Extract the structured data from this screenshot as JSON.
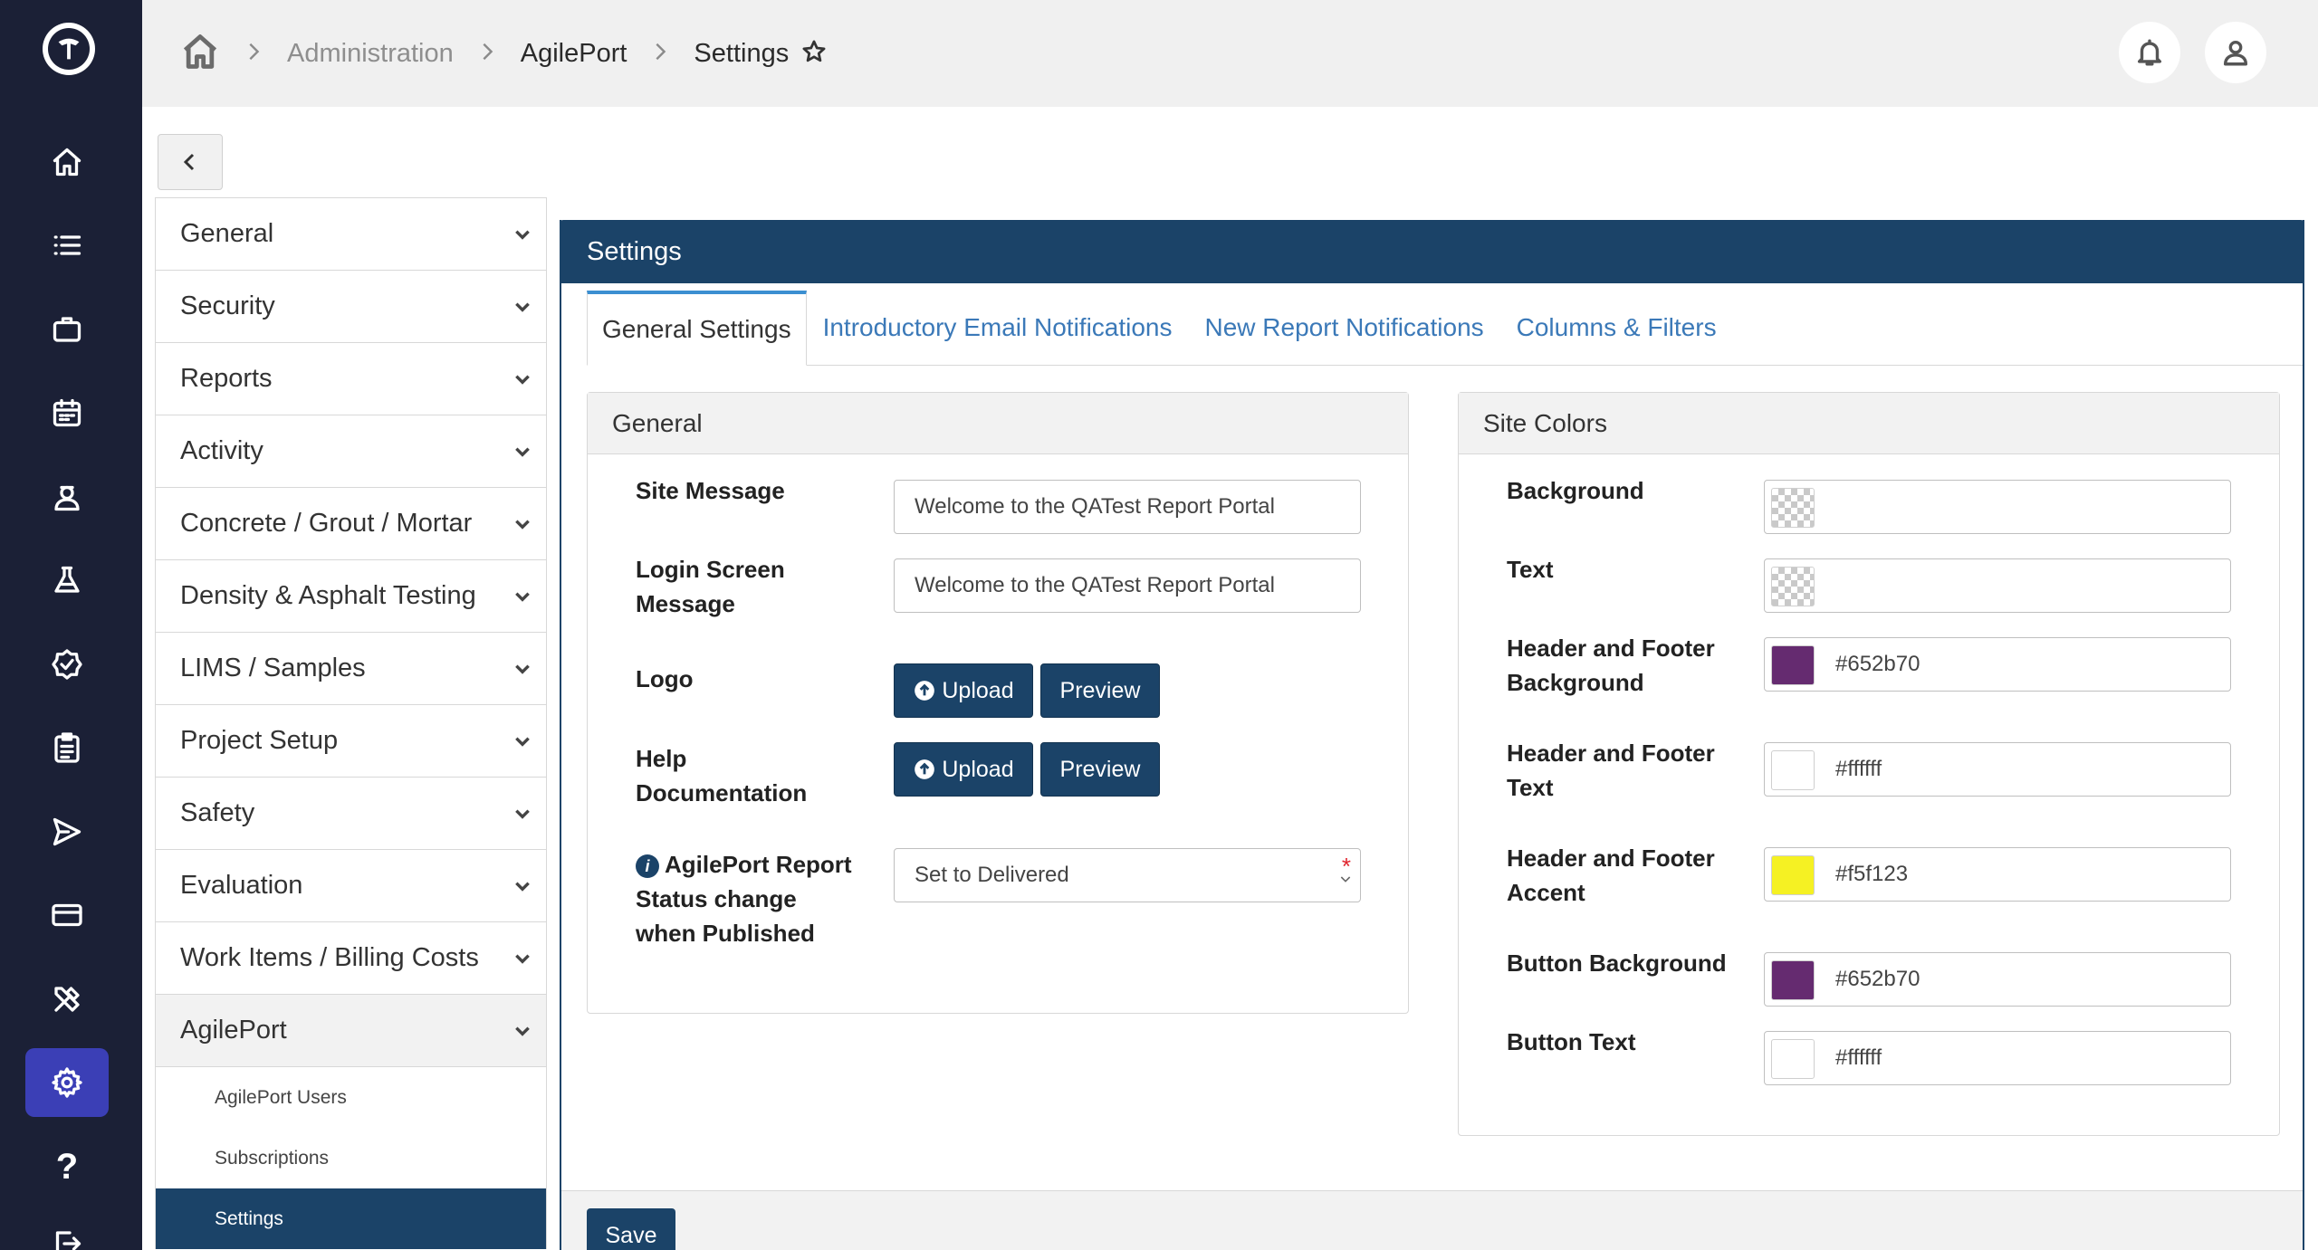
{
  "breadcrumb": {
    "items": [
      "Administration",
      "AgilePort",
      "Settings"
    ]
  },
  "sidebar": {
    "items": [
      {
        "label": "General"
      },
      {
        "label": "Security"
      },
      {
        "label": "Reports"
      },
      {
        "label": "Activity"
      },
      {
        "label": "Concrete / Grout / Mortar"
      },
      {
        "label": "Density & Asphalt Testing"
      },
      {
        "label": "LIMS / Samples"
      },
      {
        "label": "Project Setup"
      },
      {
        "label": "Safety"
      },
      {
        "label": "Evaluation"
      },
      {
        "label": "Work Items / Billing Costs"
      },
      {
        "label": "AgilePort"
      }
    ],
    "subitems": [
      "AgilePort Users",
      "Subscriptions",
      "Settings"
    ]
  },
  "panel": {
    "title": "Settings",
    "tabs": [
      "General Settings",
      "Introductory Email Notifications",
      "New Report Notifications",
      "Columns & Filters"
    ]
  },
  "general": {
    "title": "General",
    "site_message_label": "Site Message",
    "site_message_value": "Welcome to the QATest Report Portal",
    "login_label_1": "Login Screen",
    "login_label_2": "Message",
    "login_value": "Welcome to the QATest Report Portal",
    "logo_label": "Logo",
    "help_label_1": "Help",
    "help_label_2": "Documentation",
    "upload_label": "Upload",
    "preview_label": "Preview",
    "status_label_1": "AgilePort Report",
    "status_label_2": "Status change",
    "status_label_3": "when Published",
    "status_value": "Set to Delivered",
    "required_mark": "*"
  },
  "site_colors": {
    "title": "Site Colors",
    "rows": [
      {
        "label": "Background",
        "value": "",
        "color": "transparent"
      },
      {
        "label": "Text",
        "value": "",
        "color": "transparent"
      },
      {
        "label": "Header and Footer Background",
        "line1": "Header and Footer",
        "line2": "Background",
        "value": "#652b70",
        "color": "#652b70"
      },
      {
        "label": "Header and Footer Text",
        "line1": "Header and Footer",
        "line2": "Text",
        "value": "#ffffff",
        "color": "#ffffff"
      },
      {
        "label": "Header and Footer Accent",
        "line1": "Header and Footer",
        "line2": "Accent",
        "value": "#f5f123",
        "color": "#f5f123"
      },
      {
        "label": "Button Background",
        "value": "#652b70",
        "color": "#652b70"
      },
      {
        "label": "Button Text",
        "value": "#ffffff",
        "color": "#ffffff"
      }
    ]
  },
  "footer": {
    "save_label": "Save"
  },
  "theme": {
    "rail_bg": "#1b2036",
    "rail_active": "#3b3fb6",
    "primary": "#1b4368",
    "tab_link": "#3b79b8"
  },
  "icons": {
    "rail": [
      "home-icon",
      "list-icon",
      "briefcase-icon",
      "calendar-icon",
      "user-badge-icon",
      "flask-icon",
      "badge-check-icon",
      "clipboard-icon",
      "send-icon",
      "credit-card-icon",
      "tools-icon",
      "gear-icon",
      "help-icon",
      "logout-icon"
    ]
  }
}
